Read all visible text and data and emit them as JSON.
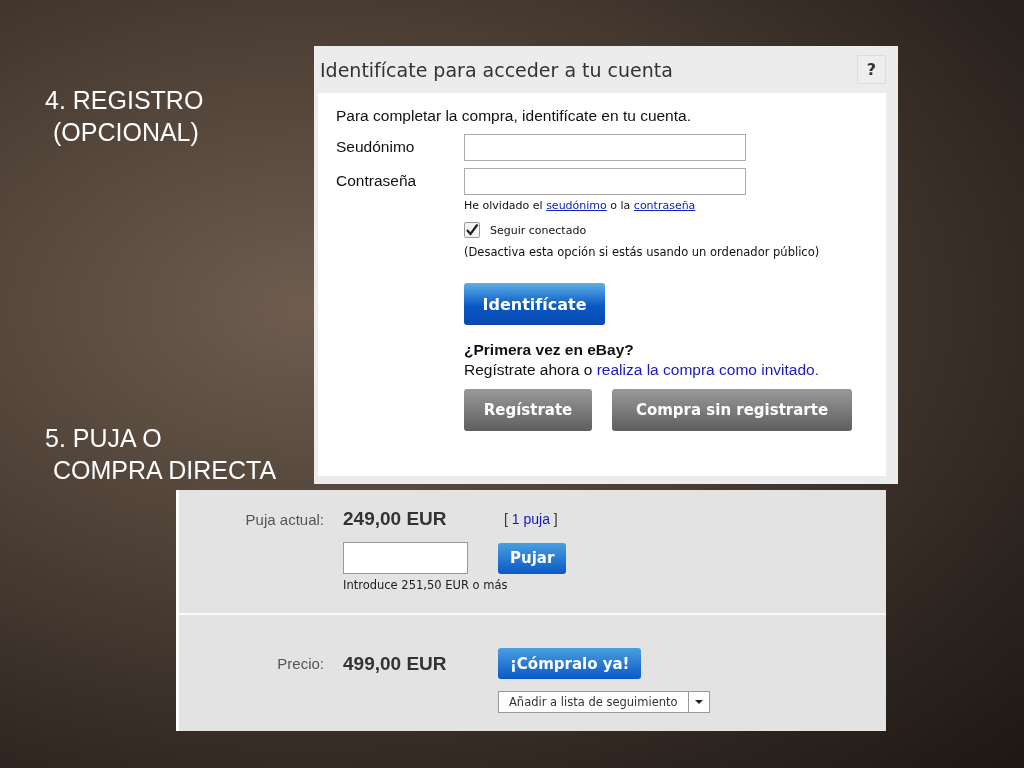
{
  "slide_headings": [
    {
      "lines": [
        "4. REGISTRO",
        "(OPCIONAL)"
      ]
    },
    {
      "lines": [
        "5. PUJA O",
        "COMPRA DIRECTA"
      ]
    }
  ],
  "login": {
    "title": "Identifícate para acceder a tu cuenta",
    "help": "?",
    "intro": "Para completar la compra, identifícate en tu cuenta.",
    "fields": [
      {
        "label": "Seudónimo"
      },
      {
        "label": "Contraseña"
      }
    ],
    "forgot": [
      {
        "text": "He olvidado el ",
        "link": false
      },
      {
        "text": "seudónimo",
        "link": true
      },
      {
        "text": " o la ",
        "link": false
      },
      {
        "text": "contraseña",
        "link": true
      }
    ],
    "remember": {
      "label": "Seguir conectado",
      "checked": true
    },
    "remember_note": "(Desactiva esta opción si estás usando un ordenador público)",
    "signin_button": "Identifícate",
    "first_time": {
      "heading": "¿Primera vez en eBay?",
      "text": [
        {
          "text": "Regístrate ahora o ",
          "link": false
        },
        {
          "text": "realiza la compra como invitado.",
          "link": true
        }
      ]
    },
    "buttons": [
      "Regístrate",
      "Compra sin registrarte"
    ]
  },
  "bid": {
    "current": {
      "label": "Puja actual:",
      "amount": "249,00 EUR",
      "bids": [
        {
          "text": "[ ",
          "link": false
        },
        {
          "text": "1 puja",
          "link": true
        },
        {
          "text": " ]",
          "link": false
        }
      ]
    },
    "bid_button": "Pujar",
    "hint": "Introduce 251,50 EUR o más",
    "price": {
      "label": "Precio:",
      "amount": "499,00 EUR"
    },
    "buy_button": "¡Cómpralo ya!",
    "watch_dropdown": "Añadir a lista de seguimiento"
  }
}
